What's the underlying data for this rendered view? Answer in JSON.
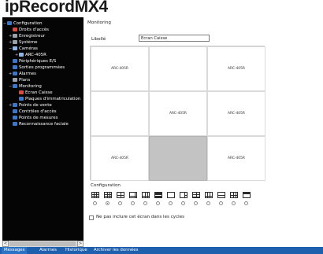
{
  "app": {
    "title": "ipRecordMX4"
  },
  "sidebar": {
    "items": [
      {
        "label": "Configuration",
        "expander": "−",
        "icon": "monitor-icon"
      },
      {
        "label": "Droits d'accès",
        "expander": "",
        "icon": "key-icon"
      },
      {
        "label": "Enregistreur",
        "expander": "+",
        "icon": "recorder-icon"
      },
      {
        "label": "Système",
        "expander": "+",
        "icon": "system-icon"
      },
      {
        "label": "Caméras",
        "expander": "−",
        "icon": "camera-icon"
      },
      {
        "label": "ARC-405R",
        "expander": "+",
        "icon": "camera-device-icon"
      },
      {
        "label": "Périphériques E/S",
        "expander": "",
        "icon": "io-icon"
      },
      {
        "label": "Sorties programmées",
        "expander": "",
        "icon": "output-icon"
      },
      {
        "label": "Alarmes",
        "expander": "+",
        "icon": "alarm-icon"
      },
      {
        "label": "Plans",
        "expander": "",
        "icon": "map-icon"
      },
      {
        "label": "Monitoring",
        "expander": "−",
        "icon": "monitor-icon"
      },
      {
        "label": "Ecran Caisse",
        "expander": "",
        "icon": "screen-icon"
      },
      {
        "label": "Plaques d'immatriculation",
        "expander": "",
        "icon": "plate-icon"
      },
      {
        "label": "Points de vente",
        "expander": "+",
        "icon": "store-icon"
      },
      {
        "label": "Contrôles d'accès",
        "expander": "",
        "icon": "access-icon"
      },
      {
        "label": "Points de mesures",
        "expander": "",
        "icon": "measure-icon"
      },
      {
        "label": "Reconnaissance faciale",
        "expander": "",
        "icon": "face-icon"
      }
    ],
    "scroll_left": "<",
    "scroll_right": ">"
  },
  "main": {
    "title": "Monitoring",
    "libelle_label": "Libellé",
    "libelle_value": "Ecran Caisse",
    "grid_cells": [
      "ARC-405R",
      "",
      "ARC-405R",
      "",
      "ARC-405R",
      "ARC-405R",
      "ARC-405R",
      "",
      "ARC-405R"
    ],
    "config_title": "Configuration",
    "layouts": [
      "layout-4x4-icon",
      "layout-3x3-icon",
      "layout-2x2-icon",
      "layout-1-plus-5-icon",
      "layout-1-plus-7-icon",
      "layout-wide-icon",
      "layout-1x1-icon",
      "layout-1-plus-3-icon",
      "layout-1-plus-12-icon",
      "layout-2-plus-8-icon",
      "layout-split-icon",
      "layout-3x2-icon",
      "layout-cinema-icon"
    ],
    "selected_layout_index": 1,
    "exclude_label": "Ne pas inclure cet écran dans les cycles",
    "exclude_checked": false
  },
  "bottom_bar": {
    "tabs": [
      "Messages",
      "Alarmes",
      "Historique",
      "Archiver les données"
    ],
    "active_index": 0
  },
  "colors": {
    "sidebar_bg": "#050505",
    "bottom_bar_bg": "#1e5fae",
    "empty_cell": "#c3c3c3"
  }
}
